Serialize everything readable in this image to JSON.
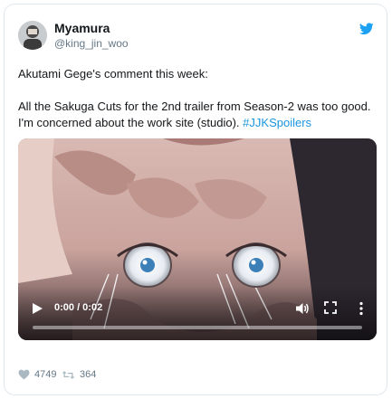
{
  "author": {
    "name": "Myamura",
    "handle": "@king_jin_woo",
    "avatar_icon": "user-avatar-icon"
  },
  "brand": {
    "icon": "twitter-bird-icon",
    "color": "#1da1f2"
  },
  "tweet": {
    "line1": "Akutami Gege's comment this week:",
    "line2": "All the Sakuga Cuts for the 2nd trailer from Season-2 was too good.",
    "line3_prefix": "I'm concerned about the work site (studio).",
    "hashtag": "#JJKSpoilers",
    "hashtag_color": "#1b95e0"
  },
  "video": {
    "time_label": "0:00 / 0:02",
    "progress": 0,
    "play_icon": "play-icon",
    "volume_icon": "volume-icon",
    "fullscreen_icon": "fullscreen-icon",
    "more_icon": "more-options-icon"
  },
  "footer": {
    "likes": "4749",
    "retweets": "364",
    "like_icon": "heart-icon",
    "retweet_icon": "retweet-icon"
  }
}
